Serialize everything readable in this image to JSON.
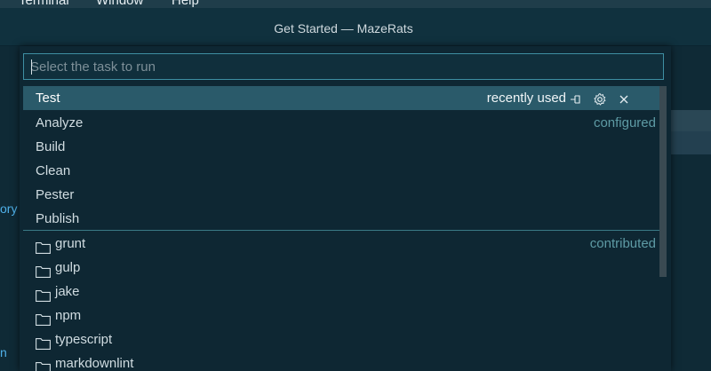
{
  "menubar": {
    "items": [
      "Terminal",
      "Window",
      "Help"
    ]
  },
  "window": {
    "title": "Get Started — MazeRats"
  },
  "background": {
    "left_fragments": [
      "ory",
      "n"
    ]
  },
  "quickpick": {
    "placeholder": "Select the task to run",
    "value": "",
    "selected": {
      "label": "Test",
      "description": "recently used",
      "actions": [
        "pin-icon",
        "gear-icon",
        "close-icon"
      ]
    },
    "configured": [
      {
        "label": "Analyze",
        "description": "configured"
      },
      {
        "label": "Build"
      },
      {
        "label": "Clean"
      },
      {
        "label": "Pester"
      },
      {
        "label": "Publish"
      }
    ],
    "contributed": [
      {
        "label": "grunt",
        "description": "contributed"
      },
      {
        "label": "gulp"
      },
      {
        "label": "jake"
      },
      {
        "label": "npm"
      },
      {
        "label": "typescript"
      },
      {
        "label": "markdownlint"
      }
    ]
  },
  "colors": {
    "background": "#0f2a36",
    "selection": "#2a5a6a",
    "input_border": "#3e8fa3",
    "description": "#5e9ba5"
  }
}
